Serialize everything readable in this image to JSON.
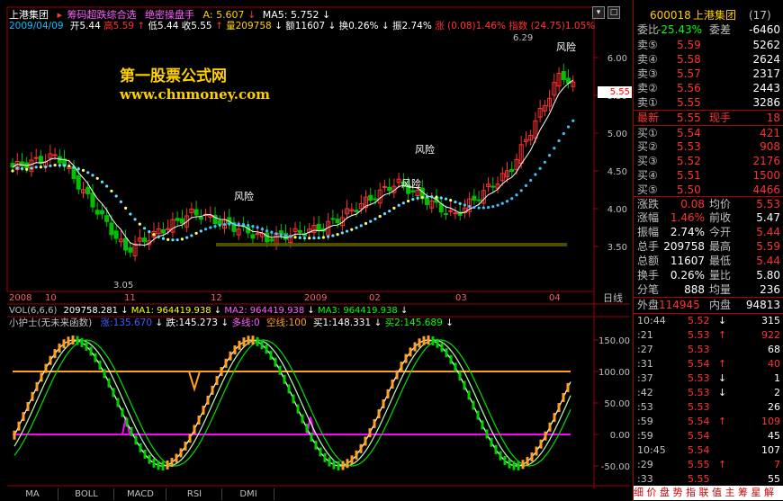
{
  "header": {
    "stock_name": "上港集团",
    "formula1": "筹码超跌综合选",
    "formula2": "绝密操盘手",
    "a_label": "A: 5.607",
    "ma5_label": "MA5: 5.752",
    "date": "2009/04/09",
    "open": "开5.44",
    "high": "高5.59",
    "low": "低5.44",
    "close": "收5.55",
    "volume": "量209758",
    "amount": "额11607",
    "turnover": "换0.26%",
    "amplitude": "振2.74%",
    "change": "涨 (0.08)1.46%",
    "index": "指数 (24.75)1.05%"
  },
  "watermark": {
    "title": "第一股票公式网",
    "url": "www.chnmoney.com"
  },
  "price_chart": {
    "y_ticks": [
      "6.00",
      "5.50",
      "5.00",
      "4.50",
      "4.00",
      "3.50"
    ],
    "y_values": [
      6.0,
      5.5,
      5.0,
      4.5,
      4.0,
      3.5
    ],
    "current_price": "5.55",
    "high_label": "6.29",
    "low_label": "3.05",
    "risk_labels": [
      "风险",
      "风险",
      "风险",
      "风险"
    ],
    "x_ticks": [
      "2008",
      "10",
      "11",
      "12",
      "2009",
      "02",
      "03",
      "04"
    ],
    "x_axis_unit": "日线"
  },
  "vol_line": {
    "name": "VOL(6,6,6)",
    "vol": "209758.281",
    "ma1": "MA1: 964419.938",
    "ma2": "MA2: 964419.938",
    "ma3": "MA3: 964419.938"
  },
  "indicator": {
    "name": "小护士(无未来函数)",
    "rise": "涨:135.670",
    "fall": "跌:145.273",
    "long": "多线:0",
    "empty": "空线:100",
    "buy1": "买1:148.331",
    "buy2": "买2:145.689",
    "y_ticks": [
      "150.00",
      "100.00",
      "50.00",
      "0.00",
      "-50.00"
    ],
    "y_values": [
      150,
      100,
      50,
      0,
      -50
    ]
  },
  "bottom_tabs": [
    "MA",
    "BOLL",
    "MACD",
    "RSI",
    "DMI"
  ],
  "quote": {
    "code": "600018",
    "name": "上港集团",
    "count": "(17)",
    "weibi_label": "委比",
    "weibi": "-25.43%",
    "weicha_label": "委差",
    "weicha": "-6460",
    "sells": [
      {
        "label": "卖⑤",
        "price": "5.59",
        "vol": "5262"
      },
      {
        "label": "卖④",
        "price": "5.58",
        "vol": "2624"
      },
      {
        "label": "卖③",
        "price": "5.57",
        "vol": "2317"
      },
      {
        "label": "卖②",
        "price": "5.56",
        "vol": "2443"
      },
      {
        "label": "卖①",
        "price": "5.55",
        "vol": "3286"
      }
    ],
    "latest_label": "最新",
    "latest": "5.55",
    "xianshou_label": "现手",
    "xianshou": "18",
    "buys": [
      {
        "label": "买①",
        "price": "5.54",
        "vol": "421"
      },
      {
        "label": "买②",
        "price": "5.53",
        "vol": "908"
      },
      {
        "label": "买③",
        "price": "5.52",
        "vol": "2176"
      },
      {
        "label": "买④",
        "price": "5.51",
        "vol": "1500"
      },
      {
        "label": "买⑤",
        "price": "5.50",
        "vol": "4466"
      }
    ],
    "stats": [
      {
        "l1": "涨跌",
        "v1": "0.08",
        "l2": "均价",
        "v2": "5.53"
      },
      {
        "l1": "涨幅",
        "v1": "1.46%",
        "l2": "前收",
        "v2": "5.47"
      },
      {
        "l1": "振幅",
        "v1": "2.74%",
        "l2": "今开",
        "v2": "5.44"
      },
      {
        "l1": "总手",
        "v1": "209758",
        "l2": "最高",
        "v2": "5.59"
      },
      {
        "l1": "总额",
        "v1": "11607",
        "l2": "最低",
        "v2": "5.44"
      },
      {
        "l1": "换手",
        "v1": "0.26%",
        "l2": "量比",
        "v2": "5.80"
      },
      {
        "l1": "分笔",
        "v1": "888",
        "l2": "均量",
        "v2": "236"
      }
    ],
    "waipan_label": "外盘",
    "waipan": "114945",
    "neipan_label": "内盘",
    "neipan": "94813",
    "ticks": [
      {
        "time": "10:44",
        "price": "5.52",
        "arrow": "↓",
        "vol": "315"
      },
      {
        "time": ":21",
        "price": "5.53",
        "arrow": "↑",
        "vol": "922"
      },
      {
        "time": ":27",
        "price": "5.53",
        "arrow": "",
        "vol": "68"
      },
      {
        "time": ":31",
        "price": "5.54",
        "arrow": "↑",
        "vol": "40"
      },
      {
        "time": ":37",
        "price": "5.53",
        "arrow": "↓",
        "vol": "1"
      },
      {
        "time": ":42",
        "price": "5.53",
        "arrow": "↓",
        "vol": "2"
      },
      {
        "time": ":53",
        "price": "5.53",
        "arrow": "",
        "vol": "26"
      },
      {
        "time": ":59",
        "price": "5.54",
        "arrow": "↑",
        "vol": "109"
      },
      {
        "time": ":59",
        "price": "5.54",
        "arrow": "",
        "vol": "45"
      },
      {
        "time": "10:45",
        "price": "5.54",
        "arrow": "",
        "vol": "107"
      },
      {
        "time": ":29",
        "price": "5.55",
        "arrow": "↑",
        "vol": "7"
      },
      {
        "time": ":33",
        "price": "5.55",
        "arrow": "",
        "vol": "55"
      }
    ],
    "footer": "细 价 盘 势 指 联 值 主 筹 星 解"
  },
  "colors": {
    "up": "#ff3232",
    "down": "#00e0e0",
    "grid": "#a00000",
    "axis": "#c00000",
    "yellow": "#ffff00",
    "magenta": "#ff00ff",
    "orange": "#ffa020"
  }
}
